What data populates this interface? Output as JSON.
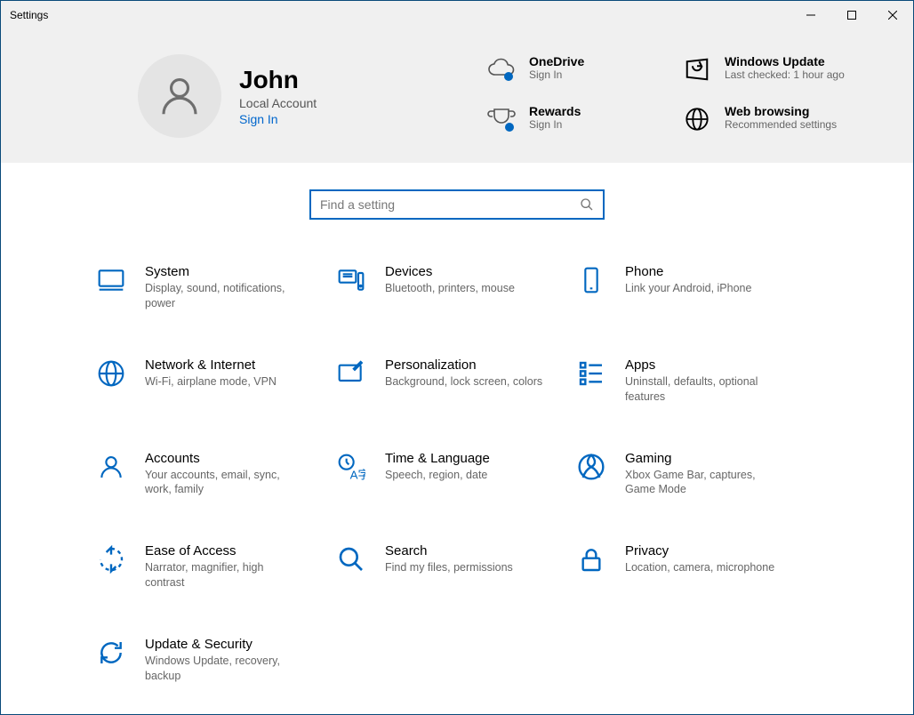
{
  "window": {
    "title": "Settings"
  },
  "user": {
    "name": "John",
    "account_type": "Local Account",
    "sign_in": "Sign In"
  },
  "status": {
    "onedrive": {
      "title": "OneDrive",
      "sub": "Sign In"
    },
    "rewards": {
      "title": "Rewards",
      "sub": "Sign In"
    },
    "update": {
      "title": "Windows Update",
      "sub": "Last checked: 1 hour ago"
    },
    "web": {
      "title": "Web browsing",
      "sub": "Recommended settings"
    }
  },
  "search": {
    "placeholder": "Find a setting"
  },
  "categories": [
    {
      "id": "system",
      "title": "System",
      "sub": "Display, sound, notifications, power"
    },
    {
      "id": "devices",
      "title": "Devices",
      "sub": "Bluetooth, printers, mouse"
    },
    {
      "id": "phone",
      "title": "Phone",
      "sub": "Link your Android, iPhone"
    },
    {
      "id": "network",
      "title": "Network & Internet",
      "sub": "Wi-Fi, airplane mode, VPN"
    },
    {
      "id": "personalization",
      "title": "Personalization",
      "sub": "Background, lock screen, colors"
    },
    {
      "id": "apps",
      "title": "Apps",
      "sub": "Uninstall, defaults, optional features"
    },
    {
      "id": "accounts",
      "title": "Accounts",
      "sub": "Your accounts, email, sync, work, family"
    },
    {
      "id": "time",
      "title": "Time & Language",
      "sub": "Speech, region, date"
    },
    {
      "id": "gaming",
      "title": "Gaming",
      "sub": "Xbox Game Bar, captures, Game Mode"
    },
    {
      "id": "ease",
      "title": "Ease of Access",
      "sub": "Narrator, magnifier, high contrast"
    },
    {
      "id": "search",
      "title": "Search",
      "sub": "Find my files, permissions"
    },
    {
      "id": "privacy",
      "title": "Privacy",
      "sub": "Location, camera, microphone"
    },
    {
      "id": "update",
      "title": "Update & Security",
      "sub": "Windows Update, recovery, backup"
    }
  ]
}
